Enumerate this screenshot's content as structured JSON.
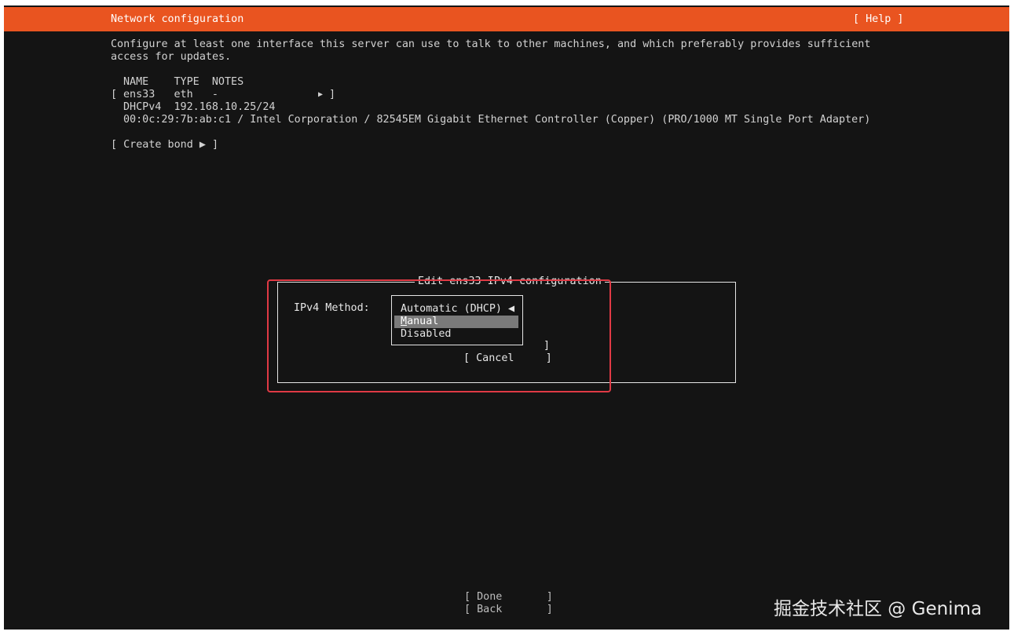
{
  "header": {
    "title": "Network configuration",
    "help_label": "[ Help ]"
  },
  "intro": {
    "line1": "Configure at least one interface this server can use to talk to other machines, and which preferably provides sufficient",
    "line2": "access for updates."
  },
  "interfaces": {
    "columns_header": "NAME    TYPE  NOTES",
    "row_open": "[",
    "row_text": "ens33   eth   -               ",
    "row_arrow": "▶",
    "row_close": "]",
    "address_line": "DHCPv4  192.168.10.25/24",
    "hw_line": "00:0c:29:7b:ab:c1 / Intel Corporation / 82545EM Gigabit Ethernet Controller (Copper) (PRO/1000 MT Single Port Adapter)"
  },
  "create_bond_label": "[ Create bond ▶ ]",
  "dialog": {
    "title": "Edit ens33 IPv4 configuration",
    "method_label": "IPv4 Method:",
    "dropdown": {
      "options": [
        {
          "label": "Automatic (DHCP) ◀"
        },
        {
          "label_first": "M",
          "label_rest": "anual"
        },
        {
          "label": "Disabled"
        }
      ],
      "selected": "Manual"
    },
    "bracket_right": "]",
    "cancel_label": "[ Cancel     ]"
  },
  "footer": {
    "done_label": "[ Done       ]",
    "back_label": "[ Back       ]"
  },
  "watermark": "掘金技术社区 @ Genima",
  "colors": {
    "header_bg": "#e95420",
    "screen_bg": "#141414",
    "highlight": "#e03a45",
    "selected_bg": "#7a7a7a"
  }
}
